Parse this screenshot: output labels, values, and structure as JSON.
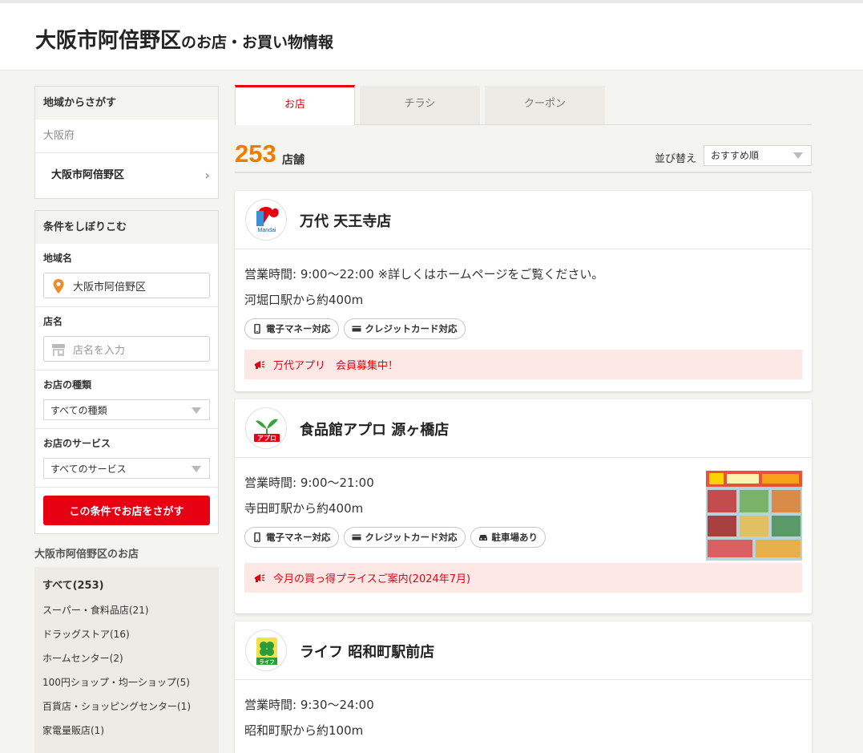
{
  "header": {
    "title_main": "大阪市阿倍野区",
    "title_sub": "のお店・お買い物情報"
  },
  "region": {
    "heading": "地域からさがす",
    "prefecture": "大阪府",
    "city": "大阪市阿倍野区"
  },
  "filters": {
    "heading": "条件をしぼりこむ",
    "area_label": "地域名",
    "area_value": "大阪市阿倍野区",
    "name_label": "店名",
    "name_placeholder": "店名を入力",
    "type_label": "お店の種類",
    "type_value": "すべての種類",
    "service_label": "お店のサービス",
    "service_value": "すべてのサービス",
    "search_button": "この条件でお店をさがす"
  },
  "categories": {
    "heading": "大阪市阿倍野区のお店",
    "items": [
      "すべて(253)",
      "スーパー・食料品店(21)",
      "ドラッグストア(16)",
      "ホームセンター(2)",
      "100円ショップ・均一ショップ(5)",
      "百貨店・ショッピングセンター(1)",
      "家電量販店(1)"
    ]
  },
  "tabs": [
    "お店",
    "チラシ",
    "クーポン"
  ],
  "count": {
    "number": "253",
    "unit": "店舗"
  },
  "sort": {
    "label": "並び替え",
    "value": "おすすめ順"
  },
  "stores": [
    {
      "name": "万代 天王寺店",
      "hours": "営業時間: 9:00〜22:00 ※詳しくはホームページをご覧ください。",
      "access": "河堀口駅から約400m",
      "tags": [
        "電子マネー対応",
        "クレジットカード対応"
      ],
      "notice": "万代アプリ　会員募集中！",
      "logo_text": "Mandai"
    },
    {
      "name": "食品館アプロ 源ヶ橋店",
      "hours": "営業時間: 9:00〜21:00",
      "access": "寺田町駅から約400m",
      "tags": [
        "電子マネー対応",
        "クレジットカード対応",
        "駐車場あり"
      ],
      "notice": "今月の買っ得プライスご案内(2024年7月)",
      "logo_text": "アプロ"
    },
    {
      "name": "ライフ 昭和町駅前店",
      "hours": "営業時間: 9:30〜24:00",
      "access": "昭和町駅から約100m",
      "logo_text": "ライフ"
    }
  ],
  "colors": {
    "brand_red": "#e60012",
    "count_orange": "#f07b00",
    "notice_bg": "#fde8e5"
  }
}
